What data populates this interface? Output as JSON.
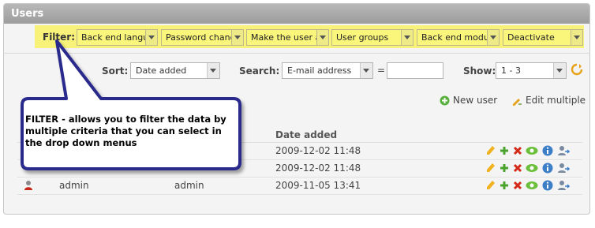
{
  "window": {
    "title": "Users"
  },
  "filter": {
    "label": "Filter:",
    "dropdowns": [
      {
        "value": "Back end langua"
      },
      {
        "value": "Password chang"
      },
      {
        "value": "Make the user a"
      },
      {
        "value": "User groups"
      },
      {
        "value": "Back end module"
      },
      {
        "value": "Deactivate"
      }
    ]
  },
  "toolbar": {
    "sort_label": "Sort:",
    "sort_value": "Date added",
    "search_label": "Search:",
    "search_field": "E-mail address",
    "equals": "=",
    "search_value": "",
    "show_label": "Show:",
    "show_value": "1 - 3"
  },
  "actions": {
    "new_user": "New user",
    "edit_multiple": "Edit multiple"
  },
  "table": {
    "columns": [
      "",
      "",
      "",
      "Date added"
    ],
    "rows": [
      {
        "name": "",
        "username": "",
        "date_added": "2009-12-02 11:48"
      },
      {
        "name": "",
        "username": "",
        "date_added": "2009-12-02 11:48"
      },
      {
        "name": "admin",
        "username": "admin",
        "date_added": "2009-11-05 13:41"
      }
    ]
  },
  "row_icons": [
    "edit-icon",
    "copy-icon",
    "delete-icon",
    "toggle-visibility-icon",
    "info-icon",
    "switch-user-icon"
  ],
  "callout": {
    "text": "FILTER - allows you to filter the data by multiple criteria that you can select in the drop down menus"
  },
  "colors": {
    "filter_highlight": "#f8f27a",
    "callout_border": "#2c2c8c",
    "callout_fill": "#ffffff"
  }
}
